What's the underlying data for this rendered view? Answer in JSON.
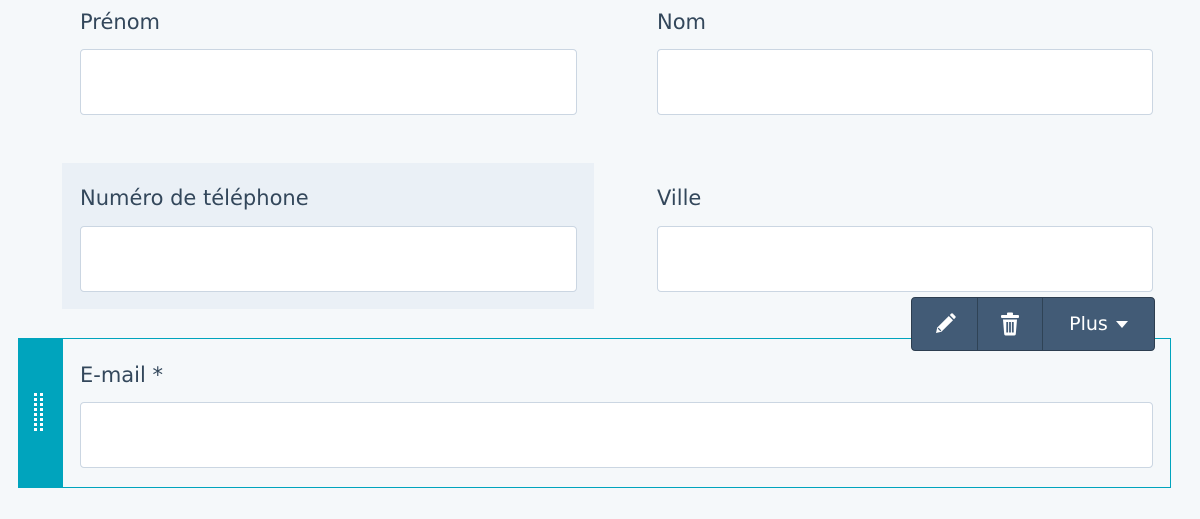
{
  "fields": {
    "prenom": {
      "label": "Prénom",
      "value": ""
    },
    "nom": {
      "label": "Nom",
      "value": ""
    },
    "telephone": {
      "label": "Numéro de téléphone",
      "value": ""
    },
    "ville": {
      "label": "Ville",
      "value": ""
    },
    "email": {
      "label": "E-mail *",
      "value": ""
    }
  },
  "toolbar": {
    "edit_icon": "pencil-icon",
    "delete_icon": "trash-icon",
    "more_label": "Plus",
    "more_icon": "caret-down-icon"
  },
  "colors": {
    "background": "#f5f8fa",
    "hover": "#eaf0f6",
    "accent": "#00a4bd",
    "toolbar": "#425b76",
    "text": "#33475b",
    "input_border": "#cbd6e2"
  }
}
